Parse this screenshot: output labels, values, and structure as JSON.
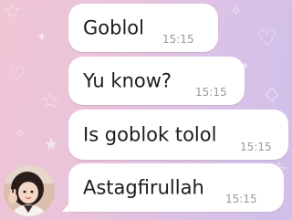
{
  "chat": {
    "messages": [
      {
        "text": "Goblol",
        "time": "15:15"
      },
      {
        "text": "Yu know?",
        "time": "15:15"
      },
      {
        "text": "Is goblok tolol",
        "time": "15:15"
      },
      {
        "text": "Astagfirullah",
        "time": "15:15"
      }
    ]
  },
  "colors": {
    "bubble": "#ffffff",
    "message_text": "#1c1c1c",
    "timestamp": "#9a9a9a",
    "background_left": "#efc6d6",
    "background_right": "#cfc0ea"
  }
}
